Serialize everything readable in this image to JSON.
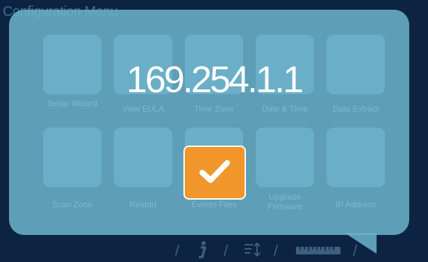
{
  "screen": {
    "title": "Configuration Menu"
  },
  "tiles": [
    {
      "label": "Setup Wizard"
    },
    {
      "label": "View EULA"
    },
    {
      "label": "Time Zone"
    },
    {
      "label": "Date & Time"
    },
    {
      "label": "Data Extract"
    },
    {
      "label": "Scan Zone"
    },
    {
      "label": "Restart"
    },
    {
      "label": "Events Files"
    },
    {
      "label": "Upgrade Firmware"
    },
    {
      "label": "IP Address"
    }
  ],
  "popup": {
    "ip_address": "169.254.1.1",
    "confirm_icon": "checkmark-icon"
  },
  "bottom_bar": {
    "icons": [
      "info-icon",
      "sort-icon",
      "ruler-icon"
    ]
  },
  "colors": {
    "background": "#0c2442",
    "popup": "#6cb2cb",
    "confirm": "#f0962a"
  }
}
